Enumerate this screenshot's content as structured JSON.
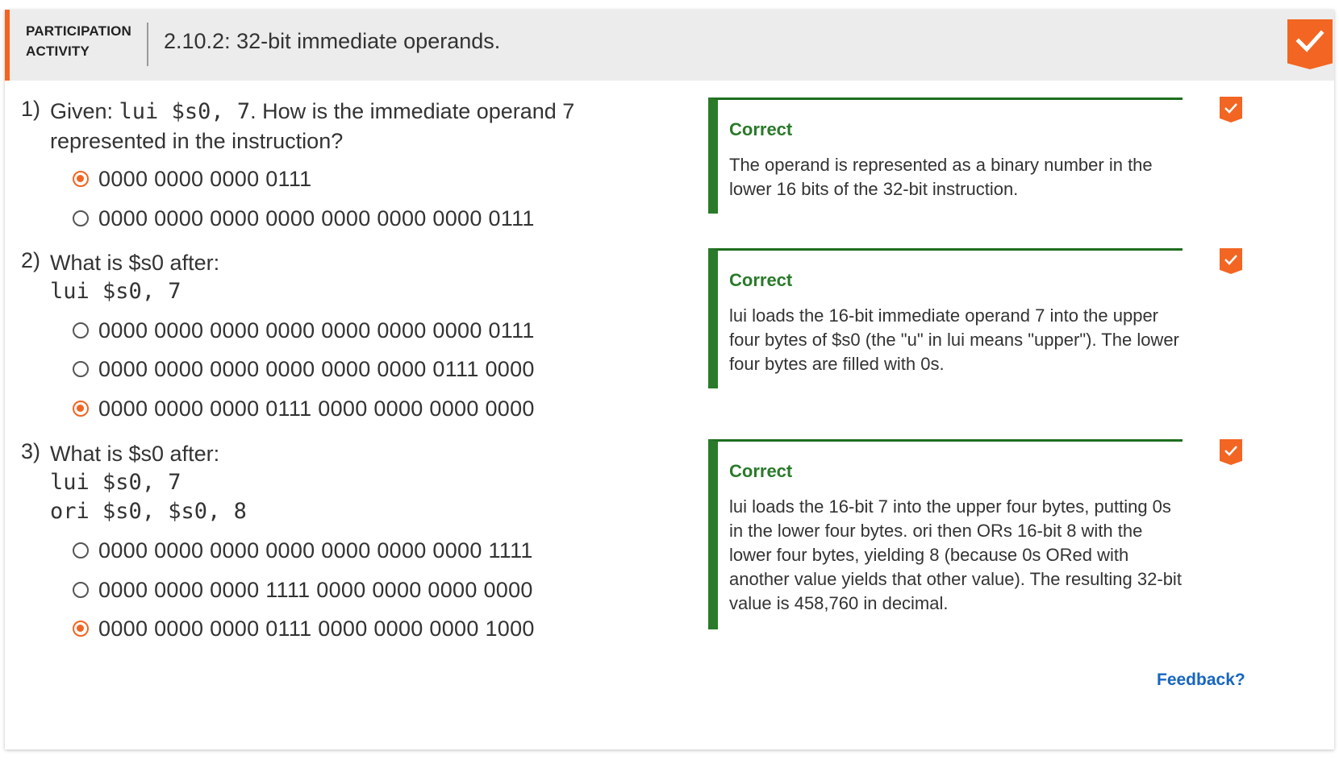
{
  "header": {
    "badge_line1": "PARTICIPATION",
    "badge_line2": "ACTIVITY",
    "title": "2.10.2: 32-bit immediate operands.",
    "complete_icon": "checkmark-icon"
  },
  "questions": [
    {
      "number": "1)",
      "text_before": "Given: ",
      "code_inline": "lui $s0, 7",
      "text_after": ". How is the immediate operand 7 represented in the instruction?",
      "options": [
        {
          "label": "0000 0000 0000 0111",
          "selected": true
        },
        {
          "label": "0000 0000 0000 0000 0000 0000 0000 0111",
          "selected": false
        }
      ],
      "feedback": {
        "title": "Correct",
        "text": "The operand is represented as a binary number in the lower 16 bits of the 32-bit instruction."
      }
    },
    {
      "number": "2)",
      "text": "What is $s0 after:",
      "code_lines": [
        "lui $s0, 7"
      ],
      "options": [
        {
          "label": "0000 0000 0000 0000 0000 0000 0000 0111",
          "selected": false
        },
        {
          "label": "0000 0000 0000 0000 0000 0000 0111 0000",
          "selected": false
        },
        {
          "label": "0000 0000 0000 0111 0000 0000 0000 0000",
          "selected": true
        }
      ],
      "feedback": {
        "title": "Correct",
        "text": "lui loads the 16-bit immediate operand 7 into the upper four bytes of $s0 (the \"u\" in lui means \"upper\"). The lower four bytes are filled with 0s."
      }
    },
    {
      "number": "3)",
      "text": "What is $s0 after:",
      "code_lines": [
        "lui $s0, 7",
        "ori $s0, $s0, 8"
      ],
      "options": [
        {
          "label": "0000 0000 0000 0000 0000 0000 0000 1111",
          "selected": false
        },
        {
          "label": "0000 0000 0000 1111 0000 0000 0000 0000",
          "selected": false
        },
        {
          "label": "0000 0000 0000 0111 0000 0000 0000 1000",
          "selected": true
        }
      ],
      "feedback": {
        "title": "Correct",
        "text": "lui loads the 16-bit 7 into the upper four bytes, putting 0s in the lower four bytes. ori then ORs 16-bit 8 with the lower four bytes, yielding 8 (because 0s ORed with another value yields that other value). The resulting 32-bit value is 458,760 in decimal."
      }
    }
  ],
  "footer": {
    "feedback_link": "Feedback?"
  },
  "colors": {
    "accent": "#f26522",
    "correct": "#2a7a2a",
    "link": "#1666c0"
  }
}
